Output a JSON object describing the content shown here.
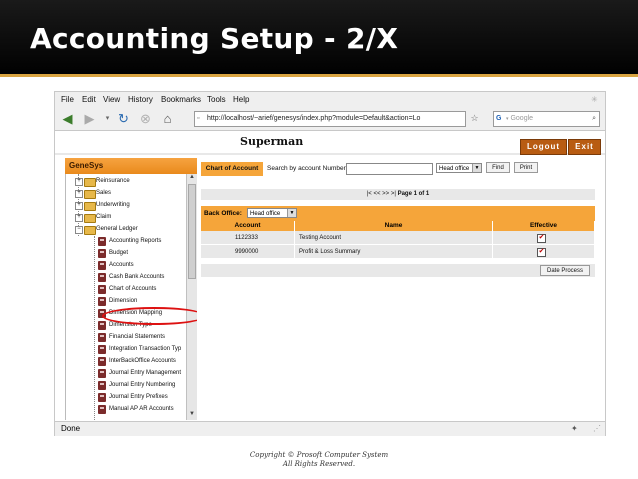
{
  "slide": {
    "title": "Accounting Setup - 2/X",
    "copyright_line1": "Copyright © Prosoft Computer System",
    "copyright_line2": "All Rights Reserved."
  },
  "browser": {
    "menu": [
      "File",
      "Edit",
      "View",
      "History",
      "Bookmarks",
      "Tools",
      "Help"
    ],
    "url": "http://localhost/~arief/genesys/index.php?module=Default&action=Lo",
    "search_placeholder": "Google",
    "status": "Done"
  },
  "app": {
    "title": "Superman",
    "logout_label": "Logout",
    "exit_label": "Exit"
  },
  "sidebar": {
    "header": "GeneSys",
    "top_items": [
      "Reinsurance",
      "Sales",
      "Underwriting",
      "Claim",
      "General Ledger"
    ],
    "gl_items": [
      "Accounting Reports",
      "Budget",
      "Accounts",
      "Cash Bank Accounts",
      "Chart of Accounts",
      "Dimension",
      "Dimension Mapping",
      "Dimension Type",
      "Financial Statements",
      "Integration Transaction Typ",
      "InterBackOffice Accounts",
      "Journal Entry Management",
      "Journal Entry Numbering",
      "Journal Entry Prefixes",
      "Manual AP AR Accounts"
    ]
  },
  "main": {
    "tab_label": "Chart of Account",
    "search_label": "Search by account Number",
    "search_value": "",
    "office_select": "Head office",
    "find_label": "Find",
    "print_label": "Print",
    "pager_nav": "|< << >> >|",
    "pager_text": "Page 1 of 1",
    "back_office_label": "Back Office:",
    "back_office_value": "Head office",
    "columns": [
      "Account",
      "Name",
      "Effective"
    ],
    "rows": [
      {
        "account": "1122333",
        "name": "Testing Account",
        "effective": "✔"
      },
      {
        "account": "9990000",
        "name": "Profit & Loss Summary",
        "effective": "✔"
      }
    ],
    "date_process_label": "Date Process"
  }
}
